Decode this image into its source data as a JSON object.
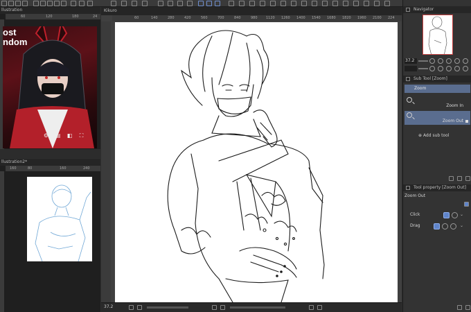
{
  "left_top_pane": {
    "tab_label": "llustration",
    "ruler_ticks": [
      "60",
      "120",
      "180",
      "24"
    ],
    "image_text": "ost\nndom"
  },
  "left_bottom_pane": {
    "tab_label": "llustration2*",
    "ruler_ticks": [
      "160",
      "80",
      "160",
      "240"
    ]
  },
  "main_pane": {
    "tab_label": "Kikuro",
    "ruler_ticks": [
      "60",
      "140",
      "280",
      "420",
      "560",
      "700",
      "840",
      "980",
      "1120",
      "1260",
      "1400",
      "1540",
      "1680",
      "1820",
      "1960",
      "2100",
      "224"
    ],
    "zoom_readout": "37.2"
  },
  "right_panels": {
    "navigator": {
      "title": "Navigator",
      "zoom_value": "37.2"
    },
    "sub_tool": {
      "title": "Sub Tool [Zoom]",
      "selected_group": "Zoom",
      "items": [
        {
          "label": "Zoom In"
        },
        {
          "label": "Zoom Out"
        }
      ],
      "add_label": "Add sub tool"
    },
    "tool_property": {
      "title": "Tool property [Zoom Out]",
      "tool_name": "Zoom Out",
      "rows": [
        {
          "label": "Click"
        },
        {
          "label": "Drag"
        }
      ]
    }
  },
  "colors": {
    "accent": "#5a6d8f",
    "selected_icon": "#5f84c9",
    "panel_bg": "#333333"
  }
}
